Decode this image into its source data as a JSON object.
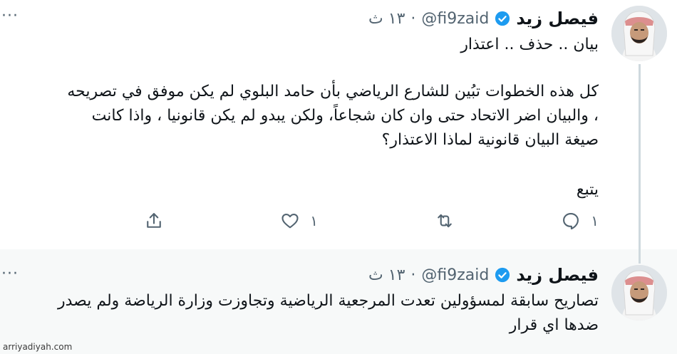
{
  "tweets": [
    {
      "display_name": "فيصل زيد",
      "handle": "@fi9zaid",
      "separator": "·",
      "time": "١٣ ث",
      "more": "···",
      "lines": [
        "بيان .. حذف .. اعتذار"
      ],
      "body": "كل هذه الخطوات تبُين للشارع الرياضي بأن حامد البلوي لم يكن موفق في تصريحه\n، والبيان اضر الاتحاد حتى وان كان شجاعاً، ولكن يبدو لم يكن قانونيا ، واذا كانت\nصيغة البيان قانونية لماذا الاعتذار؟",
      "follow": "يتبع",
      "actions": {
        "reply_count": "١",
        "retweet_count": "",
        "like_count": "١",
        "share_label": ""
      }
    },
    {
      "display_name": "فيصل زيد",
      "handle": "@fi9zaid",
      "separator": "·",
      "time": "١٣ ث",
      "more": "···",
      "body": "تصاريح سابقة لمسؤولين تعدت المرجعية الرياضية وتجاوزت وزارة الرياضة ولم يصدر\nضدها اي قرار"
    }
  ],
  "watermark": "arriyadiyah.com",
  "colors": {
    "verified": "#1d9bf0",
    "muted": "#536471",
    "text": "#0f1419"
  }
}
